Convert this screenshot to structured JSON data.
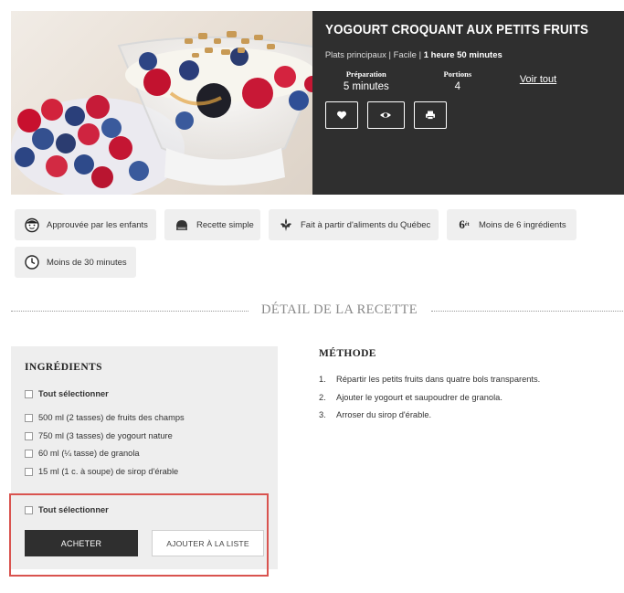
{
  "recipe": {
    "title": "YOGOURT CROQUANT AUX PETITS FRUITS",
    "category": "Plats principaux",
    "difficulty": "Facile",
    "total_time": "1 heure 50 minutes",
    "sep": " | ",
    "prep_label": "Préparation",
    "prep_value": "5 minutes",
    "portions_label": "Portions",
    "portions_value": "4",
    "see_all": "Voir tout"
  },
  "actions": [
    {
      "icon": "heart-icon"
    },
    {
      "icon": "eye-icon"
    },
    {
      "icon": "printer-icon"
    }
  ],
  "tags": [
    {
      "label": "Approuvée par les enfants",
      "icon": "kid-face-icon"
    },
    {
      "label": "Recette simple",
      "icon": "hat-icon"
    },
    {
      "label": "Fait à partir d'aliments du Québec",
      "icon": "fleur-de-lys-icon"
    },
    {
      "label": "Moins de 6 ingrédients",
      "icon": "six-icon",
      "icon_text": "6"
    },
    {
      "label": "Moins de 30 minutes",
      "icon": "clock-icon"
    }
  ],
  "section_title": "DÉTAIL DE LA RECETTE",
  "ingredients": {
    "title": "INGRÉDIENTS",
    "select_all": "Tout sélectionner",
    "items": [
      "500 ml (2 tasses) de fruits des champs",
      "750 ml (3 tasses) de yogourt nature",
      "60 ml (¼ tasse) de granola",
      "15 ml (1 c. à soupe) de sirop d'érable"
    ],
    "select_all_bottom": "Tout sélectionner",
    "buy": "ACHETER",
    "add_to_list": "AJOUTER À LA LISTE"
  },
  "method": {
    "title": "MÉTHODE",
    "steps": [
      {
        "n": "1.",
        "text": "Répartir les petits fruits dans quatre bols transparents."
      },
      {
        "n": "2.",
        "text": "Ajouter le yogourt et saupoudrer de granola."
      },
      {
        "n": "3.",
        "text": "Arroser du sirop d'érable."
      }
    ]
  },
  "colors": {
    "panel": "#2f2f2f",
    "tag_bg": "#efefef",
    "highlight": "#d9534f"
  }
}
